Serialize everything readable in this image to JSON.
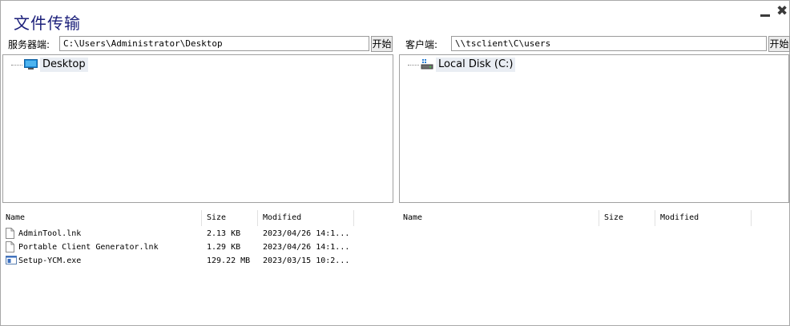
{
  "window": {
    "title": "文件传输",
    "minimize_icon": "minimize-icon",
    "close_icon": "close-icon",
    "close_glyph": "✖"
  },
  "server": {
    "label": "服务器端:",
    "path": "C:\\Users\\Administrator\\Desktop",
    "start_label": "开始",
    "tree": [
      {
        "label": "Desktop",
        "icon": "desktop-icon"
      }
    ],
    "columns": [
      "Name",
      "Size",
      "Modified"
    ],
    "files": [
      {
        "name": "AdminTool.lnk",
        "size": "2.13 KB",
        "modified": "2023/04/26 14:1...",
        "icon": "file-icon"
      },
      {
        "name": "Portable Client Generator.lnk",
        "size": "1.29 KB",
        "modified": "2023/04/26 14:1...",
        "icon": "file-icon"
      },
      {
        "name": "Setup-YCM.exe",
        "size": "129.22 MB",
        "modified": "2023/03/15 10:2...",
        "icon": "exe-icon"
      }
    ]
  },
  "client": {
    "label": "客户端:",
    "path": "\\\\tsclient\\C\\users",
    "start_label": "开始",
    "tree": [
      {
        "label": "Local Disk (C:)",
        "icon": "disk-drive-icon"
      }
    ],
    "columns": [
      "Name",
      "Size",
      "Modified"
    ],
    "files": []
  },
  "colors": {
    "title": "#1b1f7a",
    "selection": "#e9edf3",
    "border": "#a0a0a0"
  }
}
